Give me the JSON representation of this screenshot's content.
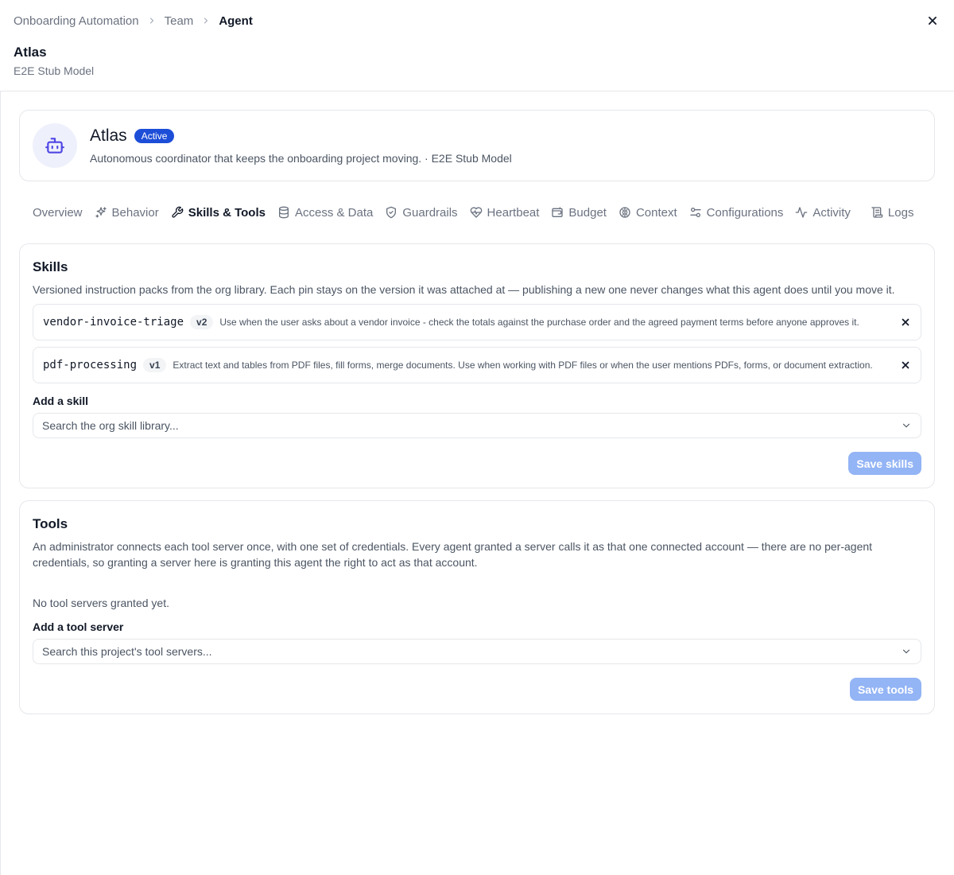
{
  "breadcrumb": [
    "Onboarding Automation",
    "Team",
    "Agent"
  ],
  "header": {
    "title": "Atlas",
    "subtitle": "E2E Stub Model"
  },
  "agent": {
    "name": "Atlas",
    "status": "Active",
    "description": "Autonomous coordinator that keeps the onboarding project moving. · E2E Stub Model"
  },
  "tabs": [
    {
      "label": "Overview",
      "icon": "none"
    },
    {
      "label": "Behavior",
      "icon": "sparkles-icon"
    },
    {
      "label": "Skills & Tools",
      "icon": "wrench-icon",
      "active": true
    },
    {
      "label": "Access & Data",
      "icon": "database-icon"
    },
    {
      "label": "Guardrails",
      "icon": "shield-check-icon"
    },
    {
      "label": "Heartbeat",
      "icon": "heart-pulse-icon"
    },
    {
      "label": "Budget",
      "icon": "wallet-icon"
    },
    {
      "label": "Context",
      "icon": "brain-icon"
    },
    {
      "label": "Configurations",
      "icon": "sliders-icon"
    },
    {
      "label": "Activity",
      "icon": "activity-icon"
    },
    {
      "label": "Logs",
      "icon": "scroll-icon"
    }
  ],
  "skills": {
    "title": "Skills",
    "description": "Versioned instruction packs from the org library. Each pin stays on the version it was attached at — publishing a new one never changes what this agent does until you move it.",
    "items": [
      {
        "name": "vendor-invoice-triage",
        "version": "v2",
        "description": "Use when the user asks about a vendor invoice - check the totals against the purchase order and the agreed payment terms before anyone approves it."
      },
      {
        "name": "pdf-processing",
        "version": "v1",
        "description": "Extract text and tables from PDF files, fill forms, merge documents. Use when working with PDF files or when the user mentions PDFs, forms, or document extraction."
      }
    ],
    "add_label": "Add a skill",
    "search_placeholder": "Search the org skill library...",
    "save_label": "Save skills"
  },
  "tools": {
    "title": "Tools",
    "description": "An administrator connects each tool server once, with one set of credentials. Every agent granted a server calls it as that one connected account — there are no per-agent credentials, so granting a server here is granting this agent the right to act as that account.",
    "empty_text": "No tool servers granted yet.",
    "add_label": "Add a tool server",
    "search_placeholder": "Search this project's tool servers...",
    "save_label": "Save tools"
  },
  "colors": {
    "accent": "#1d4ed8",
    "save_disabled": "#93b4f5",
    "border": "#e5e7eb"
  }
}
